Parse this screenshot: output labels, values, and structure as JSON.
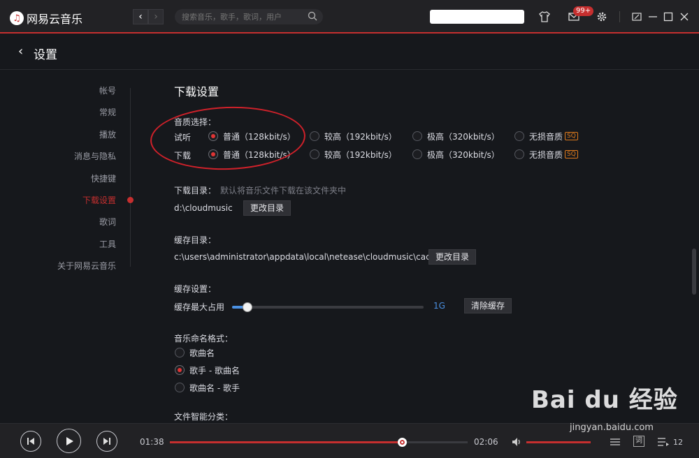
{
  "app": {
    "logo_text": "网易云音乐",
    "accent": "#c62f2f"
  },
  "header": {
    "search_placeholder": "搜索音乐，歌手，歌词，用户",
    "badge_count": "99+"
  },
  "page": {
    "title": "设置"
  },
  "sidebar": {
    "items": [
      {
        "label": "帐号",
        "active": false
      },
      {
        "label": "常规",
        "active": false
      },
      {
        "label": "播放",
        "active": false
      },
      {
        "label": "消息与隐私",
        "active": false
      },
      {
        "label": "快捷键",
        "active": false
      },
      {
        "label": "下载设置",
        "active": true
      },
      {
        "label": "歌词",
        "active": false
      },
      {
        "label": "工具",
        "active": false
      },
      {
        "label": "关于网易云音乐",
        "active": false
      }
    ]
  },
  "download": {
    "section_title": "下载设置",
    "quality_label": "音质选择：",
    "listen_label": "试听",
    "download_label": "下载",
    "options": [
      "普通（128kbit/s）",
      "较高（192kbit/s）",
      "极高（320kbit/s）",
      "无损音质"
    ],
    "sq_badge": "SQ",
    "listen_selected": 0,
    "download_selected": 0,
    "dir_label": "下载目录：",
    "dir_hint": "默认将音乐文件下载在该文件夹中",
    "dir_value": "d:\\cloudmusic",
    "change_dir": "更改目录",
    "cache_dir_label": "缓存目录：",
    "cache_dir_value": "c:\\users\\administrator\\appdata\\local\\netease\\cloudmusic\\cache",
    "cache_settings_label": "缓存设置：",
    "cache_max_label": "缓存最大占用",
    "cache_fraction": 0.08,
    "cache_value": "1G",
    "clear_cache": "清除缓存",
    "naming_label": "音乐命名格式：",
    "naming_options": [
      "歌曲名",
      "歌手 - 歌曲名",
      "歌曲名 - 歌手"
    ],
    "naming_selected": 1,
    "smart_label": "文件智能分类："
  },
  "player": {
    "current_time": "01:38",
    "total_time": "02:06",
    "progress": 0.78,
    "volume": 1.0,
    "playlist_count": "12",
    "lyrics_label": "词"
  },
  "watermark": {
    "brand": "Bai du 经验",
    "url": "jingyan.baidu.com"
  }
}
